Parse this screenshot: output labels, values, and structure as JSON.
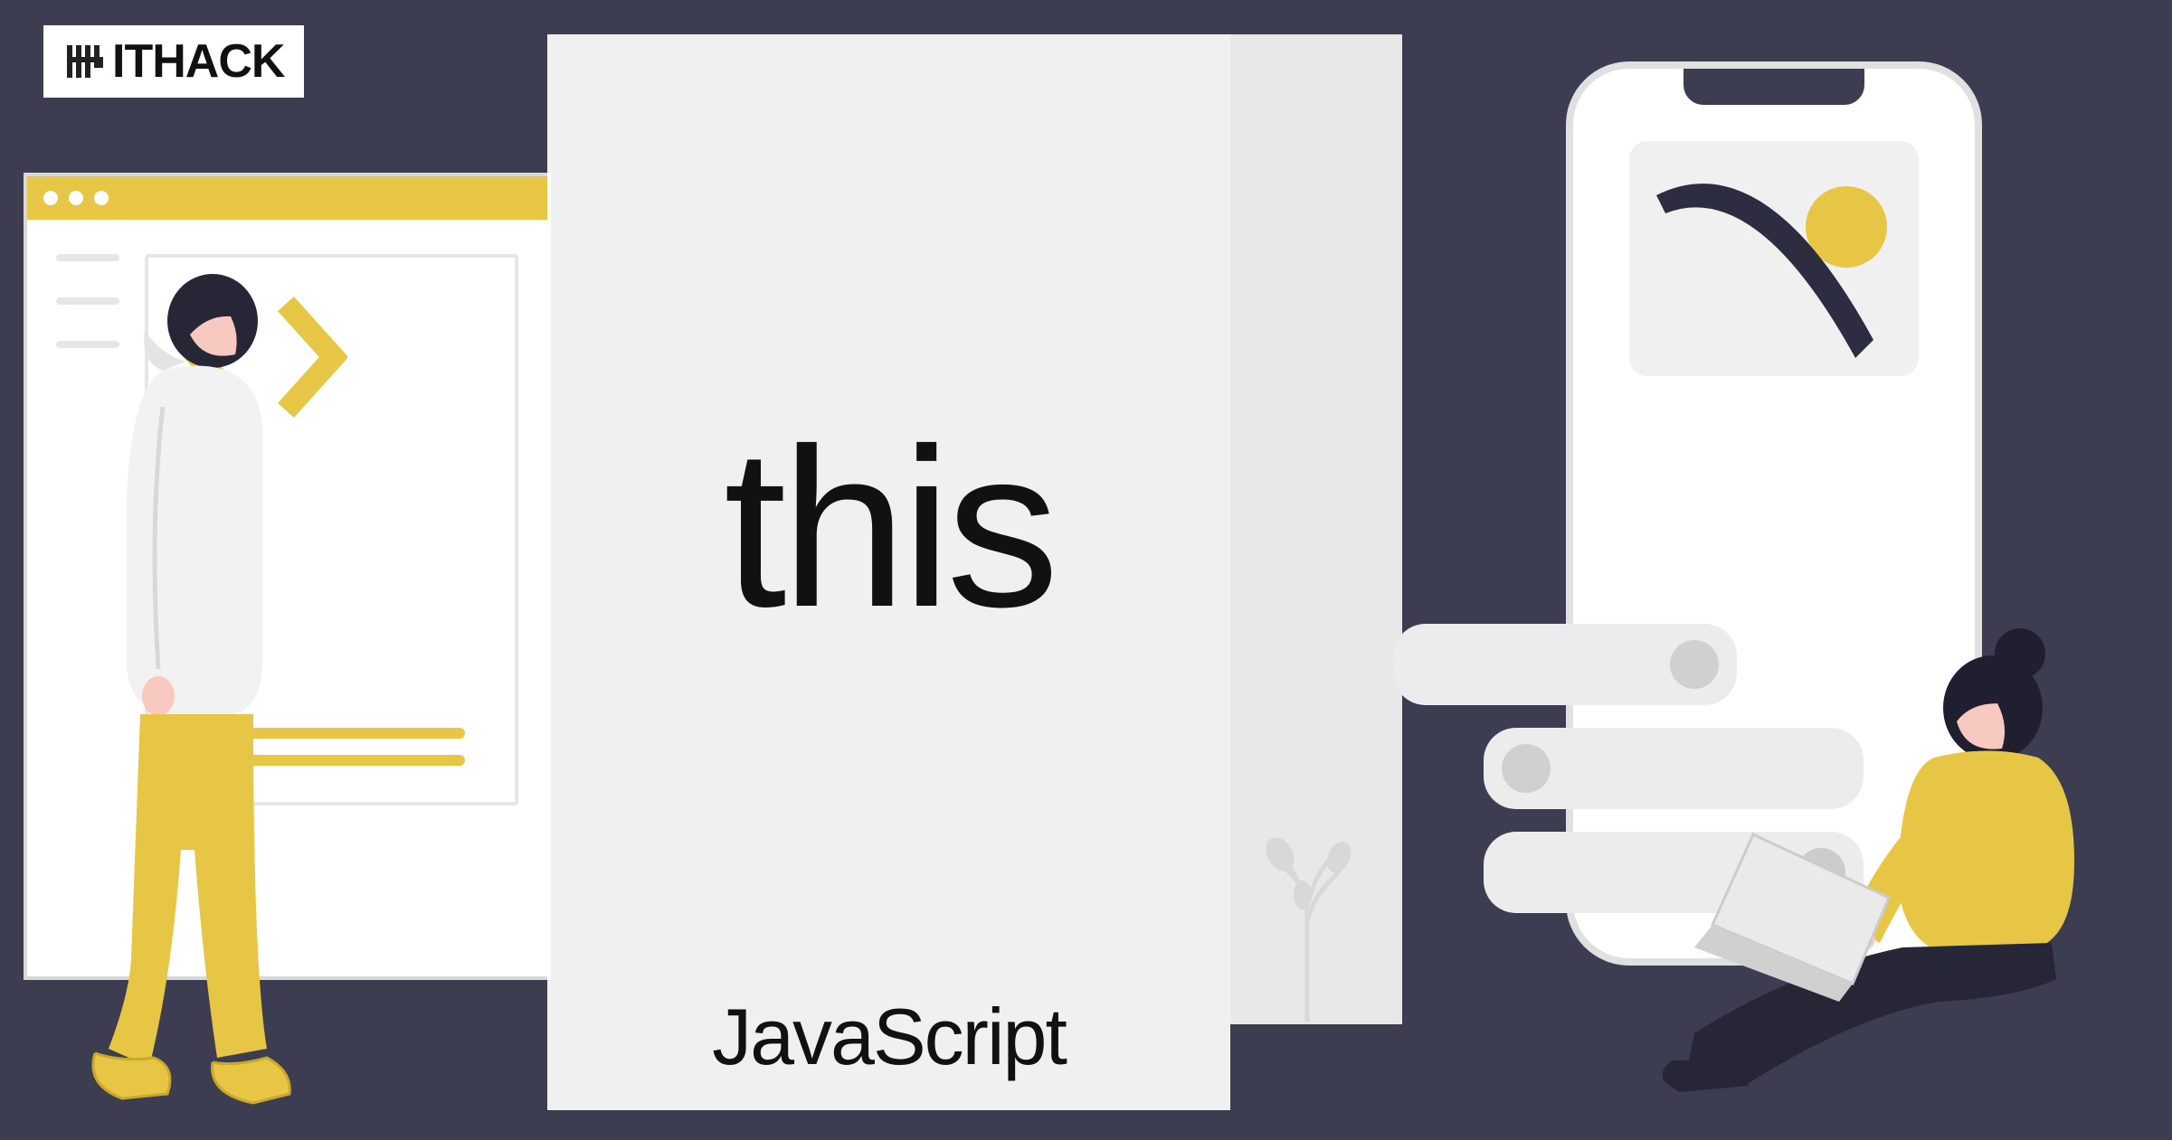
{
  "logo": {
    "text": "ITHACK"
  },
  "title": {
    "main": "this",
    "sub": "JavaScript"
  },
  "colors": {
    "background": "#3d3d52",
    "accent": "#e6c644",
    "skin": "#f7c9c0",
    "dark": "#262636"
  }
}
